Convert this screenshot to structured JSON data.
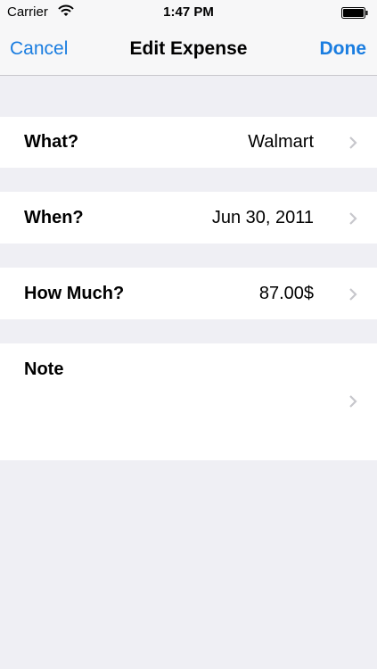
{
  "status_bar": {
    "carrier": "Carrier",
    "time": "1:47 PM"
  },
  "nav": {
    "cancel_label": "Cancel",
    "title": "Edit Expense",
    "done_label": "Done"
  },
  "fields": {
    "what": {
      "label": "What?",
      "value": "Walmart"
    },
    "when": {
      "label": "When?",
      "value": "Jun 30, 2011"
    },
    "how_much": {
      "label": "How Much?",
      "value": "87.00$"
    },
    "note": {
      "label": "Note"
    }
  },
  "colors": {
    "accent": "#1a7de0",
    "background": "#efeff4",
    "cell": "#ffffff"
  },
  "icons": [
    "wifi-icon",
    "battery-icon",
    "chevron-right-icon"
  ]
}
